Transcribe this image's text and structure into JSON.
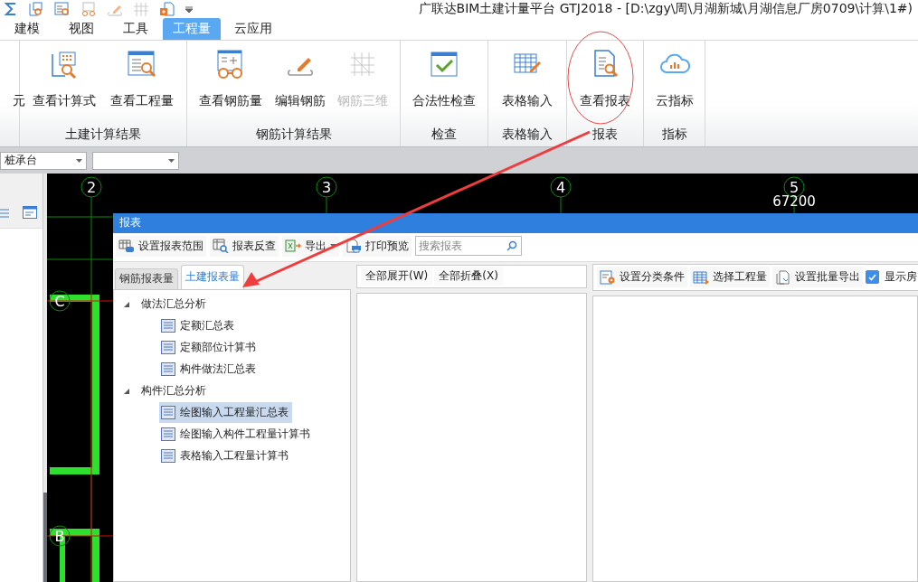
{
  "window": {
    "title": "广联达BIM土建计量平台 GTJ2018 - [D:\\zgy\\周\\月湖新城\\月湖信息厂房0709\\计算\\1#)"
  },
  "ribbon_tabs": [
    {
      "label": "建模",
      "selected": false
    },
    {
      "label": "视图",
      "selected": false
    },
    {
      "label": "工具",
      "selected": false
    },
    {
      "label": "工程量",
      "selected": true
    },
    {
      "label": "云应用",
      "selected": false
    }
  ],
  "ribbon_groups": [
    {
      "buttons": [
        {
          "label": "元",
          "kind": "none",
          "disabled": false
        }
      ]
    },
    {
      "label": "土建计算结果",
      "buttons": [
        {
          "label": "查看计算式",
          "kind": "formula",
          "disabled": false
        },
        {
          "label": "查看工程量",
          "kind": "quantity",
          "disabled": false
        }
      ]
    },
    {
      "label": "钢筋计算结果",
      "buttons": [
        {
          "label": "查看钢筋量",
          "kind": "rebar",
          "disabled": false
        },
        {
          "label": "编辑钢筋",
          "kind": "edit",
          "disabled": false
        },
        {
          "label": "钢筋三维",
          "kind": "rebar3d",
          "disabled": true
        }
      ]
    },
    {
      "label": "检查",
      "buttons": [
        {
          "label": "合法性检查",
          "kind": "check",
          "disabled": false
        }
      ]
    },
    {
      "label": "表格输入",
      "buttons": [
        {
          "label": "表格输入",
          "kind": "table",
          "disabled": false
        }
      ]
    },
    {
      "label": "报表",
      "buttons": [
        {
          "label": "查看报表",
          "kind": "report",
          "disabled": false
        }
      ]
    },
    {
      "label": "指标",
      "buttons": [
        {
          "label": "云指标",
          "kind": "cloud",
          "disabled": false
        }
      ]
    }
  ],
  "filter_dropdowns": [
    {
      "kind": "combo",
      "value": "桩承台"
    },
    {
      "kind": "combo"
    }
  ],
  "canvas": {
    "axes": [
      {
        "label": "2"
      },
      {
        "label": "3"
      },
      {
        "label": "4"
      },
      {
        "label": "5"
      }
    ],
    "dimension": "67200",
    "rows": [
      {
        "label": "C"
      },
      {
        "label": "B"
      }
    ]
  },
  "dialog": {
    "title": "报表",
    "toolbar": [
      {
        "label": "设置报表范围",
        "kind": "range",
        "has_menu": false
      },
      {
        "label": "报表反查",
        "kind": "reverse",
        "has_menu": false
      },
      {
        "label": "导出",
        "kind": "export",
        "has_menu": true
      },
      {
        "label": "打印预览",
        "kind": "print",
        "has_menu": false
      }
    ],
    "search": {
      "placeholder": "搜索报表"
    },
    "tabs": [
      {
        "label": "钢筋报表量",
        "selected": false
      },
      {
        "label": "土建报表量",
        "selected": true
      }
    ],
    "tree": [
      {
        "label": "做法汇总分析",
        "expanded": true,
        "children": [
          {
            "label": "定额汇总表",
            "selected": false
          },
          {
            "label": "定额部位计算书",
            "selected": false
          },
          {
            "label": "构件做法汇总表",
            "selected": false
          }
        ]
      },
      {
        "label": "构件汇总分析",
        "expanded": true,
        "children": [
          {
            "label": "绘图输入工程量汇总表",
            "selected": true
          },
          {
            "label": "绘图输入构件工程量计算书",
            "selected": false
          },
          {
            "label": "表格输入工程量计算书",
            "selected": false
          }
        ]
      }
    ],
    "middle_toolbar": [
      {
        "label": "全部展开(W)"
      },
      {
        "label": "全部折叠(X)"
      }
    ],
    "right_toolbar": [
      {
        "label": "设置分类条件",
        "kind": "settings"
      },
      {
        "label": "选择工程量",
        "kind": "table"
      },
      {
        "label": "设置批量导出",
        "kind": "batch"
      }
    ],
    "show_checkbox": {
      "label": "显示房",
      "checked": true
    }
  }
}
